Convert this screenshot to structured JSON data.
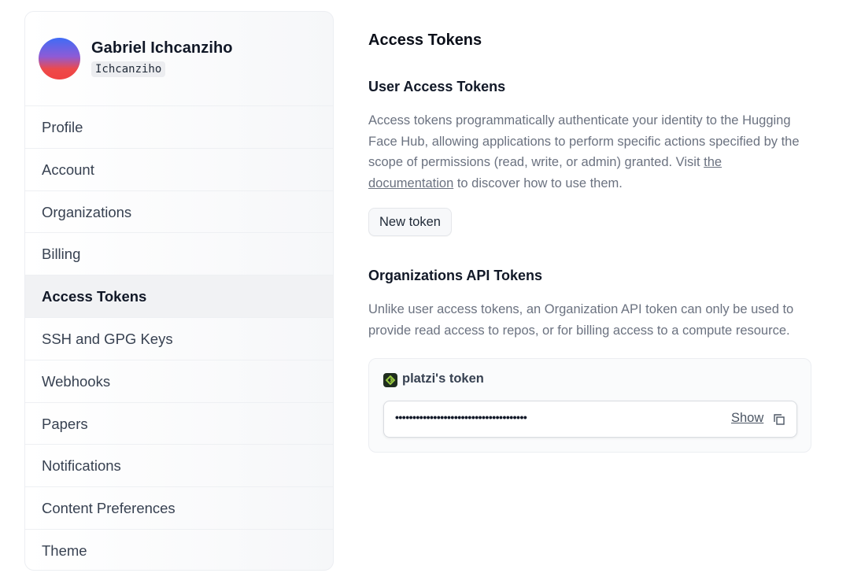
{
  "user": {
    "name": "Gabriel Ichcanziho",
    "handle": "Ichcanziho"
  },
  "sidebar": {
    "items": [
      {
        "label": "Profile",
        "active": false
      },
      {
        "label": "Account",
        "active": false
      },
      {
        "label": "Organizations",
        "active": false
      },
      {
        "label": "Billing",
        "active": false
      },
      {
        "label": "Access Tokens",
        "active": true
      },
      {
        "label": "SSH and GPG Keys",
        "active": false
      },
      {
        "label": "Webhooks",
        "active": false
      },
      {
        "label": "Papers",
        "active": false
      },
      {
        "label": "Notifications",
        "active": false
      },
      {
        "label": "Content Preferences",
        "active": false
      },
      {
        "label": "Theme",
        "active": false
      }
    ]
  },
  "main": {
    "title": "Access Tokens",
    "user_tokens": {
      "heading": "User Access Tokens",
      "description_pre": "Access tokens programmatically authenticate your identity to the Hugging Face Hub, allowing applications to perform specific actions specified by the scope of permissions (read, write, or admin) granted. Visit ",
      "doc_link": "the documentation",
      "description_post": " to discover how to use them.",
      "new_token_label": "New token"
    },
    "org_tokens": {
      "heading": "Organizations API Tokens",
      "description": "Unlike user access tokens, an Organization API token can only be used to provide read access to repos, or for billing access to a compute resource.",
      "token": {
        "org_icon": "platzi-logo-icon",
        "name": "platzi's token",
        "masked_value": "••••••••••••••••••••••••••••••••••••••",
        "show_label": "Show",
        "copy_icon": "copy-icon"
      }
    }
  },
  "colors": {
    "active_nav_bg": "#f1f2f4",
    "muted_text": "#6b7280",
    "org_logo_green": "#98ca3f"
  }
}
